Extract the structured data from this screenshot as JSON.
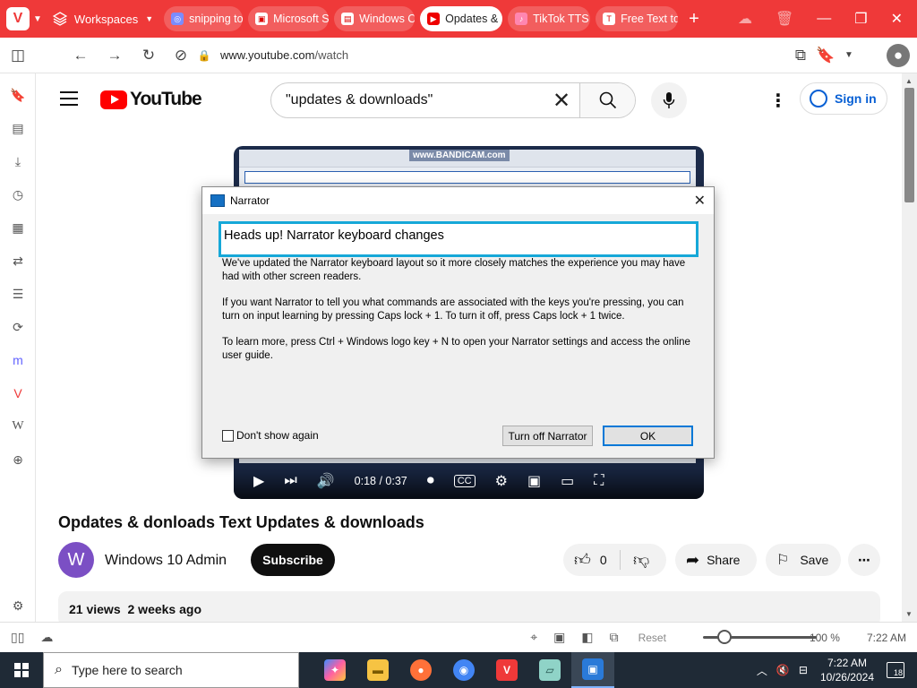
{
  "browser": {
    "workspaces_label": "Workspaces",
    "tabs": [
      {
        "label": "snipping to"
      },
      {
        "label": "Microsoft S"
      },
      {
        "label": "Windows C"
      },
      {
        "label": "Opdates &",
        "active": true
      },
      {
        "label": "TikTok TTS"
      },
      {
        "label": "Free Text to"
      }
    ],
    "url_host": "www.youtube.com",
    "url_path": "/watch"
  },
  "youtube": {
    "logo_text": "YouTube",
    "search_query": "\"updates & downloads\"",
    "sign_in": "Sign in",
    "video": {
      "watermark": "www.BANDICAM.com",
      "time": "0:18 / 0:37",
      "progress_fraction": 0.486
    },
    "title": "Opdates & donloads Text Updates & downloads",
    "channel_initial": "W",
    "channel_name": "Windows 10 Admin",
    "subscribe": "Subscribe",
    "likes": "0",
    "share": "Share",
    "save": "Save",
    "views": "21 views",
    "age": "2 weeks ago"
  },
  "narrator_dialog": {
    "title": "Narrator",
    "heading": "Heads up! Narrator keyboard changes",
    "para1": "We've updated the Narrator keyboard layout so it more closely matches the experience you may have had with other screen readers.",
    "para2": "If you want Narrator to tell you what commands are associated with the keys you're pressing, you can turn on input learning by pressing Caps lock + 1. To turn it off, press Caps lock + 1 twice.",
    "para3": "To learn more, press Ctrl + Windows logo key + N to open your Narrator settings and access the online user guide.",
    "checkbox_label": "Don't show again",
    "turn_off_button": "Turn off Narrator",
    "ok_button": "OK"
  },
  "statusbar": {
    "reset": "Reset",
    "zoom": "100 %",
    "time": "7:22 AM"
  },
  "taskbar": {
    "search_placeholder": "Type here to search",
    "clock_time": "7:22 AM",
    "clock_date": "10/26/2024",
    "notification_count": "18"
  },
  "colors": {
    "vivaldi_red": "#ef3939",
    "youtube_red": "#ff0000",
    "focus_cyan": "#16a8d8",
    "taskbar": "#1f2a36"
  }
}
